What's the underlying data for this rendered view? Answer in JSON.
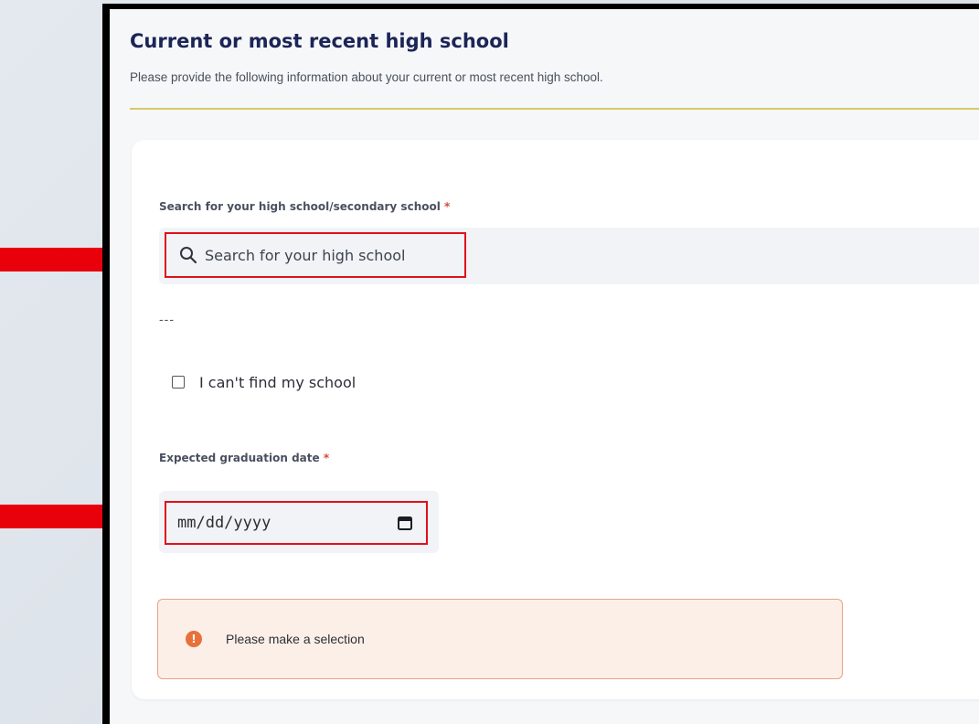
{
  "section": {
    "title": "Current or most recent high school",
    "subtitle": "Please provide the following information about your current or most recent high school."
  },
  "search": {
    "label": "Search for your high school/secondary school",
    "required_mark": "*",
    "placeholder": "Search for your high school",
    "icon": "search-icon"
  },
  "separator_text": "---",
  "cant_find": {
    "label": "I can't find my school",
    "checked": false
  },
  "graduation": {
    "label": "Expected graduation date",
    "required_mark": "*",
    "placeholder": "mm/dd/yyyy",
    "icon": "calendar-icon"
  },
  "alert": {
    "icon_text": "!",
    "message": "Please make a selection"
  },
  "colors": {
    "title": "#1c2556",
    "highlight_border": "#e0101a",
    "arrow": "#e8000b",
    "divider": "#d9c96b",
    "alert_bg": "#fcefe8",
    "alert_icon": "#e8703a"
  }
}
